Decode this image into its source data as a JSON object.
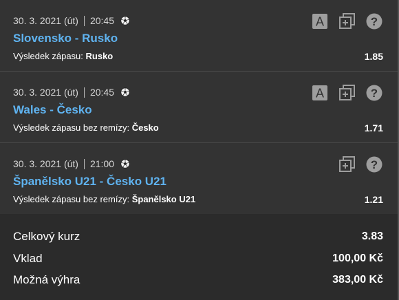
{
  "bets": [
    {
      "date": "30. 3. 2021 (út)",
      "time": "20:45",
      "sport_icon": "soccer-ball-icon",
      "match": "Slovensko - Rusko",
      "market": "Výsledek zápasu: ",
      "pick": "Rusko",
      "odds": "1.85",
      "has_a_icon": true
    },
    {
      "date": "30. 3. 2021 (út)",
      "time": "20:45",
      "sport_icon": "soccer-ball-icon",
      "match": "Wales - Česko",
      "market": "Výsledek zápasu bez remízy: ",
      "pick": "Česko",
      "odds": "1.71",
      "has_a_icon": true
    },
    {
      "date": "30. 3. 2021 (út)",
      "time": "21:00",
      "sport_icon": "soccer-ball-icon",
      "match": "Španělsko U21 - Česko U21",
      "market": "Výsledek zápasu bez remízy: ",
      "pick": "Španělsko U21",
      "odds": "1.21",
      "has_a_icon": false
    }
  ],
  "icons": {
    "a_label": "A",
    "help_label": "?"
  },
  "totals": {
    "total_odds_label": "Celkový kurz",
    "total_odds_value": "3.83",
    "stake_label": "Vklad",
    "stake_value": "100,00 Kč",
    "win_label": "Možná výhra",
    "win_value": "383,00 Kč"
  },
  "colors": {
    "match_link": "#5fb3f0",
    "panel": "#333333",
    "background": "#2b2b2b",
    "icon": "#9e9e9e"
  }
}
